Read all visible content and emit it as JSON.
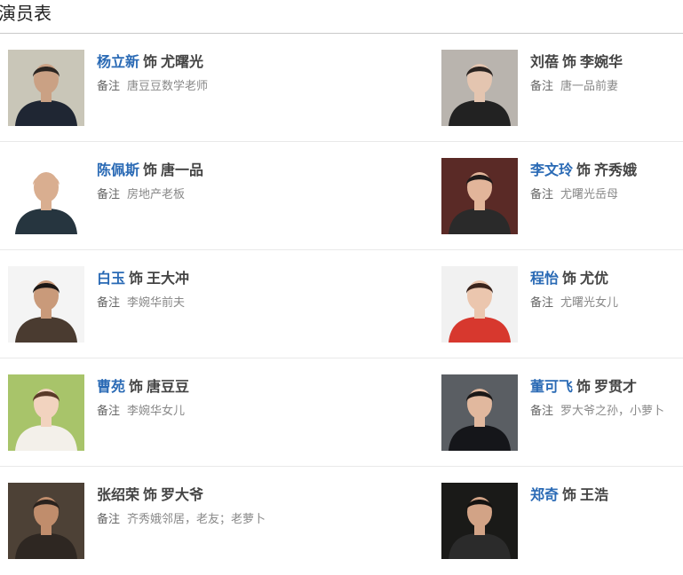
{
  "section": {
    "title": "演员表"
  },
  "role_separator": "饰",
  "note_label": "备注",
  "cast": [
    {
      "actor": "杨立新",
      "role": "尤曙光",
      "note": "唐豆豆数学老师",
      "linked": true,
      "photo": {
        "bg": "#c9c6b8",
        "skin": "#caa184",
        "hair": "#2b2521",
        "shirt": "#1f2633"
      }
    },
    {
      "actor": "刘蓓",
      "role": "李婉华",
      "note": "唐一品前妻",
      "linked": false,
      "photo": {
        "bg": "#b9b4ae",
        "skin": "#e4c5b0",
        "hair": "#2a2320",
        "shirt": "#222222"
      }
    },
    {
      "actor": "陈佩斯",
      "role": "唐一品",
      "note": "房地产老板",
      "linked": true,
      "photo": {
        "bg": "#ffffff",
        "skin": "#d9ae90",
        "hair": "#d9ae90",
        "shirt": "#26353f"
      }
    },
    {
      "actor": "李文玲",
      "role": "齐秀娥",
      "note": "尤曙光岳母",
      "linked": true,
      "photo": {
        "bg": "#5a2a26",
        "skin": "#e2b59a",
        "hair": "#1e1a1a",
        "shirt": "#2a2a2a"
      }
    },
    {
      "actor": "白玉",
      "role": "王大冲",
      "note": "李婉华前夫",
      "linked": true,
      "photo": {
        "bg": "#f4f4f4",
        "skin": "#c99a7a",
        "hair": "#1c1816",
        "shirt": "#4a3b30"
      }
    },
    {
      "actor": "程怡",
      "role": "尤优",
      "note": "尤曙光女儿",
      "linked": true,
      "photo": {
        "bg": "#f1f1f1",
        "skin": "#ebc6ae",
        "hair": "#3a241c",
        "shirt": "#d7382e"
      }
    },
    {
      "actor": "曹苑",
      "role": "唐豆豆",
      "note": "李婉华女儿",
      "linked": true,
      "photo": {
        "bg": "#a8c46a",
        "skin": "#f2d3bf",
        "hair": "#5a3a28",
        "shirt": "#f3f0ea"
      }
    },
    {
      "actor": "董可飞",
      "role": "罗贯才",
      "note": "罗大爷之孙，小萝卜",
      "linked": true,
      "photo": {
        "bg": "#5a5e63",
        "skin": "#e1b89e",
        "hair": "#1b1817",
        "shirt": "#15161a"
      }
    },
    {
      "actor": "张绍荣",
      "role": "罗大爷",
      "note": "齐秀娥邻居，老友；老萝卜",
      "linked": false,
      "photo": {
        "bg": "#4d4136",
        "skin": "#c08d6c",
        "hair": "#2a221d",
        "shirt": "#2e2722"
      }
    },
    {
      "actor": "郑奇",
      "role": "王浩",
      "note": "",
      "linked": true,
      "photo": {
        "bg": "#1a1a18",
        "skin": "#d2a386",
        "hair": "#141210",
        "shirt": "#2b2b2b"
      }
    }
  ]
}
